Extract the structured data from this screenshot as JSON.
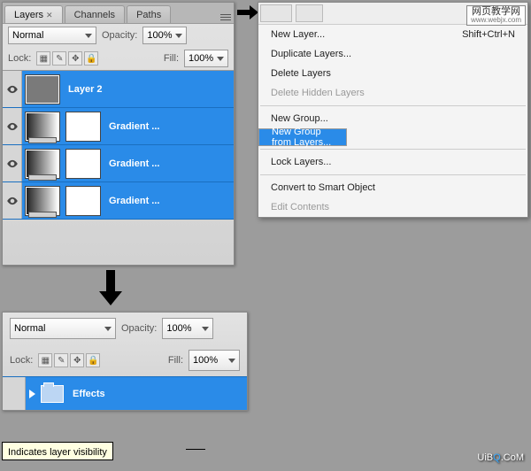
{
  "tabs": {
    "layers": "Layers",
    "channels": "Channels",
    "paths": "Paths"
  },
  "blend": {
    "mode": "Normal",
    "opacity_label": "Opacity:",
    "opacity_value": "100%"
  },
  "lock": {
    "label": "Lock:",
    "fill_label": "Fill:",
    "fill_value": "100%"
  },
  "layers": [
    {
      "name": "Layer 2"
    },
    {
      "name": "Gradient ..."
    },
    {
      "name": "Gradient ..."
    },
    {
      "name": "Gradient ..."
    }
  ],
  "menu": {
    "tabs": [
      "",
      ""
    ],
    "new_layer": "New Layer...",
    "new_layer_shortcut": "Shift+Ctrl+N",
    "duplicate": "Duplicate Layers...",
    "delete": "Delete Layers",
    "delete_hidden": "Delete Hidden Layers",
    "new_group": "New Group...",
    "new_group_from": "New Group from Layers...",
    "lock": "Lock Layers...",
    "convert": "Convert to Smart Object",
    "edit_contents": "Edit Contents"
  },
  "bottom": {
    "mode": "Normal",
    "opacity_label": "Opacity:",
    "opacity_value": "100%",
    "lock_label": "Lock:",
    "fill_label": "Fill:",
    "fill_value": "100%",
    "group_name": "Effects"
  },
  "tooltip": "Indicates layer visibility",
  "watermark1": {
    "cn": "网页教学网",
    "url": "www.webjx.com"
  },
  "watermark2": {
    "a": "UiB",
    "b": "Q",
    "c": ".CoM"
  }
}
